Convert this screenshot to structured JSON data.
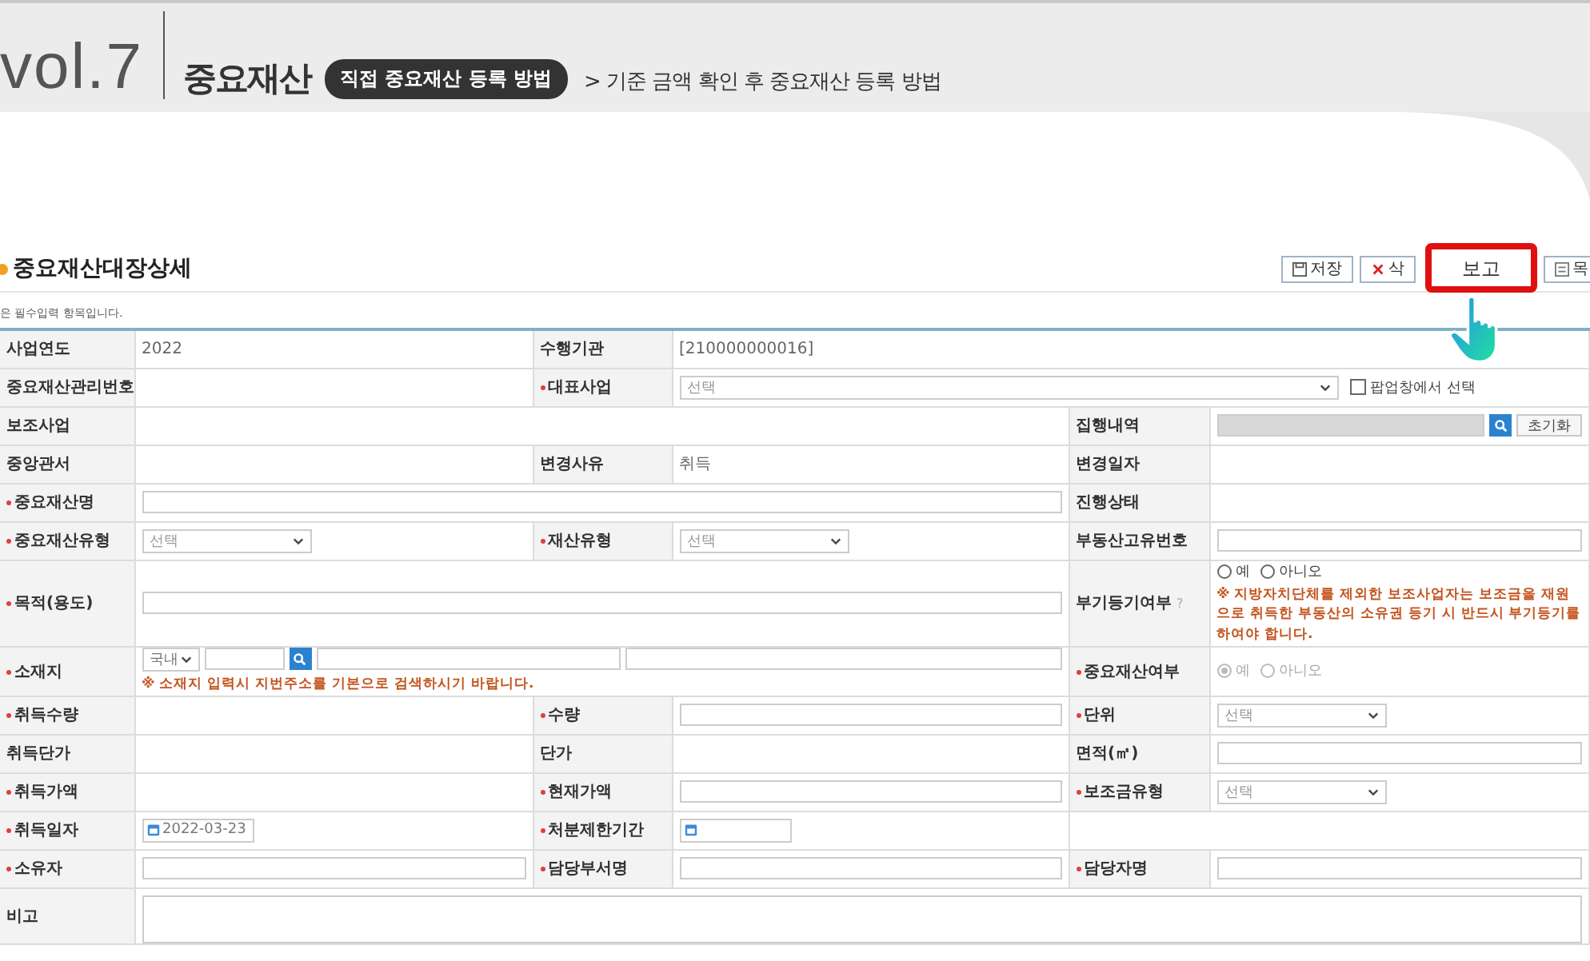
{
  "banner": {
    "volume": "vol.7",
    "topic": "중요재산",
    "badge": "직접 중요재산 등록 방법",
    "subtitle": "> 기준 금액 확인 후 중요재산 등록 방법"
  },
  "page": {
    "title": "중요재산대장상세",
    "required_note": "은 필수입력 항목입니다.",
    "buttons": [
      {
        "kind": "save",
        "label": "저장",
        "highlighted": false
      },
      {
        "kind": "delete",
        "label": "삭",
        "highlighted": false
      },
      {
        "kind": "plain",
        "label": "보고",
        "highlighted": true
      },
      {
        "kind": "list",
        "label": "목",
        "highlighted": false
      }
    ]
  },
  "rows": [
    {
      "cells": [
        {
          "kind": "label",
          "text": "사업연도",
          "required": false
        },
        {
          "kind": "text",
          "text": "2022"
        },
        {
          "kind": "label",
          "text": "수행기관",
          "required": false
        },
        {
          "kind": "text",
          "text": "[210000000016]"
        }
      ]
    },
    {
      "cells": [
        {
          "kind": "label",
          "text": "중요재산관리번호",
          "required": false
        },
        {
          "kind": "blank"
        },
        {
          "kind": "label",
          "text": "대표사업",
          "required": true
        },
        {
          "kind": "rep_select",
          "value": "선택",
          "checkbox": {
            "label": "팝업창에서 선택",
            "checked": false
          }
        }
      ]
    },
    {
      "cells": [
        {
          "kind": "label",
          "text": "보조사업",
          "required": false
        },
        {
          "kind": "blank"
        },
        {
          "kind": "label",
          "text": "집행내역",
          "required": false
        },
        {
          "kind": "lookup",
          "button": "초기화"
        }
      ]
    },
    {
      "cells": [
        {
          "kind": "label",
          "text": "중앙관서",
          "required": false
        },
        {
          "kind": "blank"
        },
        {
          "kind": "label",
          "text": "변경사유",
          "required": false
        },
        {
          "kind": "text",
          "text": "취득"
        },
        {
          "kind": "label",
          "text": "변경일자",
          "required": false
        },
        {
          "kind": "blank"
        }
      ]
    },
    {
      "cells": [
        {
          "kind": "label",
          "text": "중요재산명",
          "required": true
        },
        {
          "kind": "input"
        },
        {
          "kind": "label",
          "text": "진행상태",
          "required": false
        },
        {
          "kind": "blank"
        }
      ]
    },
    {
      "cells": [
        {
          "kind": "label",
          "text": "중요재산유형",
          "required": true
        },
        {
          "kind": "select",
          "value": "선택"
        },
        {
          "kind": "label",
          "text": "재산유형",
          "required": true
        },
        {
          "kind": "select",
          "value": "선택"
        },
        {
          "kind": "label",
          "text": "부동산고유번호",
          "required": false
        },
        {
          "kind": "input"
        }
      ]
    },
    {
      "cells": [
        {
          "kind": "label",
          "text": "목적(용도)",
          "required": true
        },
        {
          "kind": "input"
        },
        {
          "kind": "label",
          "text": "부기등기여부",
          "required": false,
          "help": "?"
        },
        {
          "kind": "radio",
          "disabled": false,
          "options": [
            {
              "label": "예",
              "selected": false
            },
            {
              "label": "아니오",
              "selected": false
            }
          ],
          "note": "※ 지방자치단체를 제외한 보조사업자는 보조금을 재원으로 취득한 부동산의 소유권 등기 시 반드시 부기등기를 하여야 합니다."
        }
      ]
    },
    {
      "cells": [
        {
          "kind": "label",
          "text": "소재지",
          "required": true
        },
        {
          "kind": "address",
          "region": "국내",
          "note": "※ 소재지 입력시 지번주소를 기본으로 검색하시기 바랍니다."
        },
        {
          "kind": "label",
          "text": "중요재산여부",
          "required": true
        },
        {
          "kind": "radio",
          "disabled": true,
          "options": [
            {
              "label": "예",
              "selected": true
            },
            {
              "label": "아니오",
              "selected": false
            }
          ]
        }
      ]
    },
    {
      "cells": [
        {
          "kind": "label",
          "text": "취득수량",
          "required": true
        },
        {
          "kind": "blank"
        },
        {
          "kind": "label",
          "text": "수량",
          "required": true
        },
        {
          "kind": "input"
        },
        {
          "kind": "label",
          "text": "단위",
          "required": true
        },
        {
          "kind": "select",
          "value": "선택"
        }
      ]
    },
    {
      "cells": [
        {
          "kind": "label",
          "text": "취득단가",
          "required": false
        },
        {
          "kind": "blank"
        },
        {
          "kind": "label",
          "text": "단가",
          "required": false
        },
        {
          "kind": "blank"
        },
        {
          "kind": "label",
          "text": "면적(㎡)",
          "required": false
        },
        {
          "kind": "input"
        }
      ]
    },
    {
      "cells": [
        {
          "kind": "label",
          "text": "취득가액",
          "required": true
        },
        {
          "kind": "blank"
        },
        {
          "kind": "label",
          "text": "현재가액",
          "required": true
        },
        {
          "kind": "input"
        },
        {
          "kind": "label",
          "text": "보조금유형",
          "required": true
        },
        {
          "kind": "select",
          "value": "선택"
        }
      ]
    },
    {
      "cells": [
        {
          "kind": "label",
          "text": "취득일자",
          "required": true
        },
        {
          "kind": "date",
          "value": "2022-03-23"
        },
        {
          "kind": "label",
          "text": "처분제한기간",
          "required": true
        },
        {
          "kind": "date"
        },
        {
          "kind": "blank"
        }
      ]
    },
    {
      "cells": [
        {
          "kind": "label",
          "text": "소유자",
          "required": true
        },
        {
          "kind": "input"
        },
        {
          "kind": "label",
          "text": "담당부서명",
          "required": true
        },
        {
          "kind": "input"
        },
        {
          "kind": "label",
          "text": "담당자명",
          "required": true
        },
        {
          "kind": "input"
        }
      ]
    },
    {
      "cells": [
        {
          "kind": "label",
          "text": "비고",
          "required": false
        },
        {
          "kind": "textarea"
        }
      ]
    }
  ]
}
